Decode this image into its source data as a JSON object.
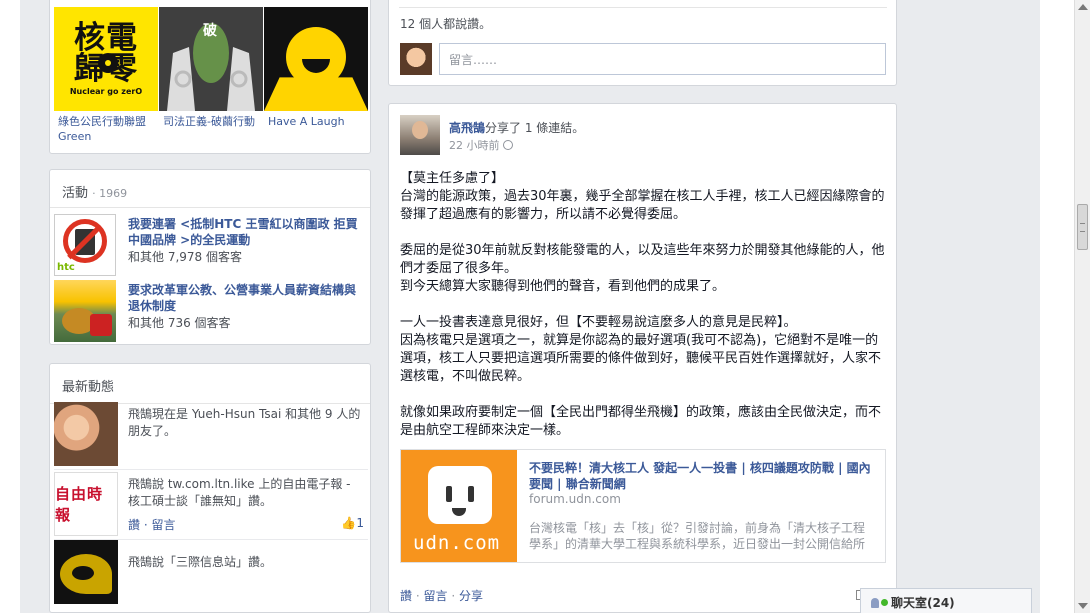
{
  "pages": {
    "items": [
      {
        "label": "綠色公民行動聯盟Green",
        "thumb_text": "核電\n歸零",
        "thumb_sub": "Nuclear go zerO"
      },
      {
        "label": "司法正義-破繭行動"
      },
      {
        "label": "Have A Laugh"
      }
    ]
  },
  "events": {
    "title": "活動",
    "count": "· 1969",
    "items": [
      {
        "title": "我要連署 <抵制HTC 王雪紅以商圍政 拒買中國品牌 >的全民運動",
        "sub": "和其他 7,978 個客客"
      },
      {
        "title": "要求改革軍公教、公營事業人員薪資結構與退休制度",
        "sub": "和其他 736 個客客"
      }
    ]
  },
  "activity": {
    "title": "最新動態",
    "items": [
      {
        "text": "飛鵠現在是 Yueh-Hsun Tsai 和其他 9 人的朋友了。"
      },
      {
        "text": "飛鵠說 tw.com.ltn.like 上的自由電子報 - 核工碩士談「誰無知」讚。",
        "actions": "讚 · 留言",
        "likes": "1",
        "thumb_text": "自由時報"
      },
      {
        "text": "飛鵠說「三際信息站」讚。"
      }
    ]
  },
  "comment_box": {
    "likes_line": "12 個人都說讚。",
    "placeholder": "留言……"
  },
  "post": {
    "author": "高飛鵠",
    "verb": "分享了 1 條連結。",
    "time": "22 小時前",
    "paragraphs": [
      "【莫主任多慮了】\n台灣的能源政策，過去30年裏，幾乎全部掌握在核工人手裡，核工人已經因緣際會的發揮了超過應有的影響力，所以請不必覺得委屈。",
      "委屈的是從30年前就反對核能發電的人，以及這些年來努力於開發其他綠能的人，他們才委屈了很多年。\n到今天總算大家聽得到他們的聲音，看到他們的成果了。",
      "一人一投書表達意見很好，但【不要輕易說這麼多人的意見是民粹】。\n因為核電只是選項之一，就算是你認為的最好選項(我可不認為)，它絕對不是唯一的選項，核工人只要把這選項所需要的條件做到好，聽候平民百姓作選擇就好，人家不選核電，不叫做民粹。",
      "就像如果政府要制定一個【全民出門都得坐飛機】的政策，應該由全民做決定，而不是由航空工程師來決定一樣。"
    ],
    "link": {
      "title": "不要民粹！清大核工人 發起一人一投書 | 核四議題攻防戰 | 國內要聞 | 聯合新聞網",
      "domain": "forum.udn.com",
      "desc": "台灣核電「核」去「核」從？引發討論，前身為「清大核子工程學系」的清華大學工程與系統科學系，近日發出一封公開信給所",
      "image_text": "udn.com"
    },
    "actions": {
      "like": "讚",
      "comment": "留言",
      "share": "分享"
    }
  },
  "chat": {
    "label": "聊天室(24)"
  }
}
